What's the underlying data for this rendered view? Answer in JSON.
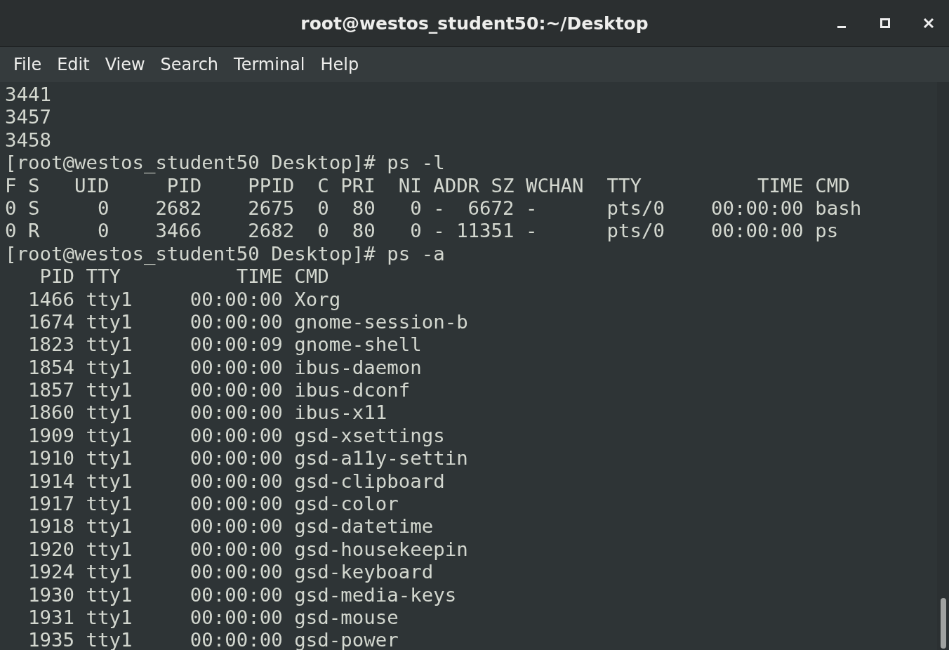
{
  "window": {
    "title": "root@westos_student50:~/Desktop"
  },
  "menu": [
    "File",
    "Edit",
    "View",
    "Search",
    "Terminal",
    "Help"
  ],
  "terminal": {
    "lines": [
      "3441",
      "3457",
      "3458",
      "[root@westos_student50 Desktop]# ps -l",
      "F S   UID     PID    PPID  C PRI  NI ADDR SZ WCHAN  TTY          TIME CMD",
      "0 S     0    2682    2675  0  80   0 -  6672 -      pts/0    00:00:00 bash",
      "0 R     0    3466    2682  0  80   0 - 11351 -      pts/0    00:00:00 ps",
      "[root@westos_student50 Desktop]# ps -a",
      "   PID TTY          TIME CMD",
      "  1466 tty1     00:00:00 Xorg",
      "  1674 tty1     00:00:00 gnome-session-b",
      "  1823 tty1     00:00:09 gnome-shell",
      "  1854 tty1     00:00:00 ibus-daemon",
      "  1857 tty1     00:00:00 ibus-dconf",
      "  1860 tty1     00:00:00 ibus-x11",
      "  1909 tty1     00:00:00 gsd-xsettings",
      "  1910 tty1     00:00:00 gsd-a11y-settin",
      "  1914 tty1     00:00:00 gsd-clipboard",
      "  1917 tty1     00:00:00 gsd-color",
      "  1918 tty1     00:00:00 gsd-datetime",
      "  1920 tty1     00:00:00 gsd-housekeepin",
      "  1924 tty1     00:00:00 gsd-keyboard",
      "  1930 tty1     00:00:00 gsd-media-keys",
      "  1931 tty1     00:00:00 gsd-mouse",
      "  1935 tty1     00:00:00 gsd-power"
    ]
  }
}
